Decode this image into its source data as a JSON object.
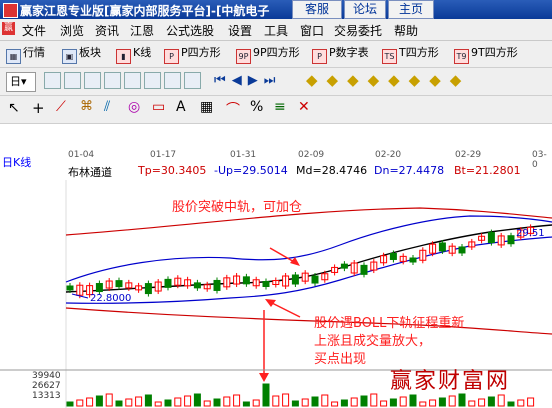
{
  "window": {
    "title": "赢家江恩专业版[赢家内部服务平台]-[中航电子",
    "tabs": [
      "客服",
      "论坛",
      "主页"
    ]
  },
  "menu": [
    "文件",
    "浏览",
    "资讯",
    "江恩",
    "公式选股",
    "设置",
    "工具",
    "窗口",
    "交易委托",
    "帮助"
  ],
  "toolbar1": [
    {
      "label": "行情",
      "icon": "grid-icon"
    },
    {
      "label": "板块",
      "icon": "block-icon"
    },
    {
      "label": "K线",
      "icon": "kline-icon"
    },
    {
      "label": "P四方形",
      "icon": "P"
    },
    {
      "label": "9P四方形",
      "icon": "9P"
    },
    {
      "label": "P数字表",
      "icon": "P"
    },
    {
      "label": "T四方形",
      "icon": "TS"
    },
    {
      "label": "9T四方形",
      "icon": "T9"
    }
  ],
  "toolbar2_period": "日",
  "chart": {
    "period_label": "日K线",
    "dates": [
      "01-04",
      "01-17",
      "01-31",
      "02-09",
      "02-20",
      "02-29",
      "03-0"
    ],
    "indicator": {
      "name": "布林通道",
      "tp": "Tp=30.3405",
      "up": "-Up=29.5014",
      "md": "Md=28.4746",
      "dn": "Dn=27.4478",
      "bt": "Bt=21.2801"
    },
    "price_high_label": "29.51",
    "price_low_label": "22.8000",
    "volume_labels": [
      "39940",
      "26627",
      "13313"
    ],
    "annotations": {
      "breakout": "股价突破中轨，可加仓",
      "buy_line1": "股价遇BOLL下轨征程重新",
      "buy_line2": "上涨且成交量放大，",
      "buy_line3": "买点出现"
    },
    "watermark": "赢家财富网"
  },
  "colors": {
    "title_bg": "#0a3a98",
    "up": "#ff0000",
    "down": "#008000",
    "upper_band": "#0000cc",
    "middle_band": "#000000",
    "lower_band": "#0000cc",
    "far_band": "#cc0000",
    "annotation": "#ff2020"
  }
}
